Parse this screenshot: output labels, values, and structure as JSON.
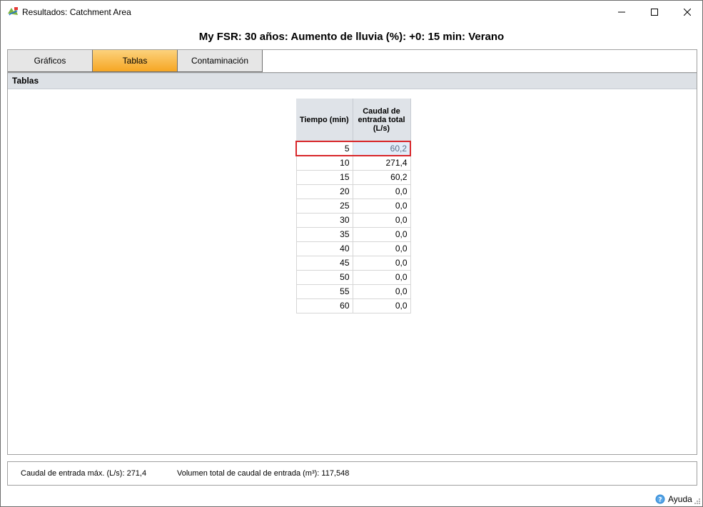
{
  "window": {
    "title": "Resultados: Catchment Area"
  },
  "report_title": "My FSR: 30 años: Aumento de lluvia (%): +0: 15 min: Verano",
  "tabs": [
    {
      "label": "Gráficos",
      "active": false
    },
    {
      "label": "Tablas",
      "active": true
    },
    {
      "label": "Contaminación",
      "active": false
    }
  ],
  "panel": {
    "header": "Tablas"
  },
  "table": {
    "columns": [
      "Tiempo (min)",
      "Caudal de entrada total (L/s)"
    ],
    "rows": [
      [
        "5",
        "60,2"
      ],
      [
        "10",
        "271,4"
      ],
      [
        "15",
        "60,2"
      ],
      [
        "20",
        "0,0"
      ],
      [
        "25",
        "0,0"
      ],
      [
        "30",
        "0,0"
      ],
      [
        "35",
        "0,0"
      ],
      [
        "40",
        "0,0"
      ],
      [
        "45",
        "0,0"
      ],
      [
        "50",
        "0,0"
      ],
      [
        "55",
        "0,0"
      ],
      [
        "60",
        "0,0"
      ]
    ],
    "selected_row": 0
  },
  "summary": {
    "max_inflow": "Caudal de entrada máx. (L/s): 271,4",
    "total_volume": "Volumen total de caudal de entrada (m³): 117,548"
  },
  "help": {
    "label": "Ayuda",
    "icon": "help-icon"
  },
  "colors": {
    "active_tab_top": "#fcd27c",
    "active_tab_bottom": "#f6a623",
    "selection_border": "#d8262a",
    "header_bg": "#dde1e6"
  }
}
